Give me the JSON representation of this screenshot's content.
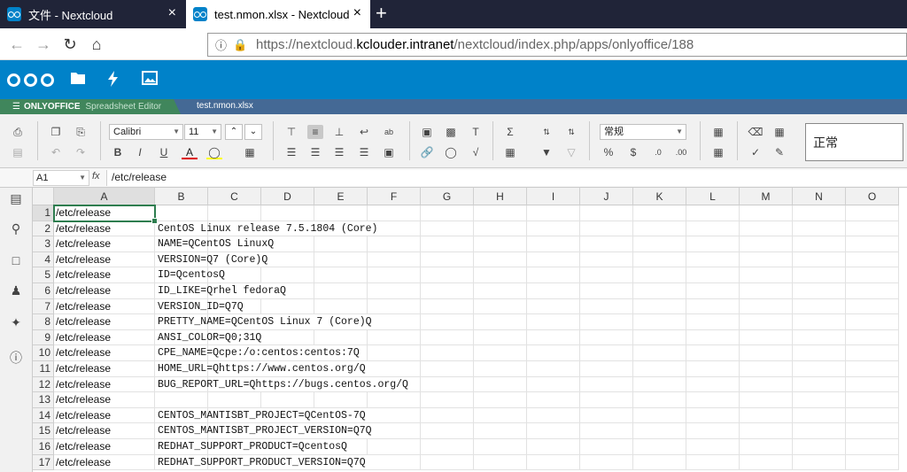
{
  "browser": {
    "tabs": [
      {
        "title": "文件 - Nextcloud",
        "active": false
      },
      {
        "title": "test.nmon.xlsx - Nextcloud",
        "active": true
      }
    ],
    "new_tab_label": "+",
    "close_label": "×",
    "url_scheme": "https://nextcloud.",
    "url_host": "kclouder.intranet",
    "url_path": "/nextcloud/index.php/apps/onlyoffice/188"
  },
  "nextcloud": {
    "apps": [
      "files-icon",
      "activity-icon",
      "gallery-icon"
    ],
    "brand_color": "#0082c9"
  },
  "onlyoffice": {
    "brand": "ONLYOFFICE",
    "editor_label": "Spreadsheet Editor",
    "file_name": "test.nmon.xlsx"
  },
  "toolbar": {
    "font_name": "Calibri",
    "font_size": "11",
    "number_format": "常规",
    "cell_style": "正常"
  },
  "formula_bar": {
    "cell_ref": "A1",
    "fx": "fx",
    "value": "/etc/release"
  },
  "grid": {
    "columns": [
      "A",
      "B",
      "C",
      "D",
      "E",
      "F",
      "G",
      "H",
      "I",
      "J",
      "K",
      "L",
      "M",
      "N",
      "O"
    ],
    "selected_column": "A",
    "selected_row": 1,
    "rows": [
      {
        "n": "1",
        "a": "/etc/release",
        "b": ""
      },
      {
        "n": "2",
        "a": "/etc/release",
        "b": "CentOS Linux release 7.5.1804 (Core)"
      },
      {
        "n": "3",
        "a": "/etc/release",
        "b": "NAME=QCentOS LinuxQ"
      },
      {
        "n": "4",
        "a": "/etc/release",
        "b": "VERSION=Q7 (Core)Q"
      },
      {
        "n": "5",
        "a": "/etc/release",
        "b": "ID=QcentosQ"
      },
      {
        "n": "6",
        "a": "/etc/release",
        "b": "ID_LIKE=Qrhel fedoraQ"
      },
      {
        "n": "7",
        "a": "/etc/release",
        "b": "VERSION_ID=Q7Q"
      },
      {
        "n": "8",
        "a": "/etc/release",
        "b": "PRETTY_NAME=QCentOS Linux 7 (Core)Q"
      },
      {
        "n": "9",
        "a": "/etc/release",
        "b": "ANSI_COLOR=Q0;31Q"
      },
      {
        "n": "10",
        "a": "/etc/release",
        "b": "CPE_NAME=Qcpe:/o:centos:centos:7Q"
      },
      {
        "n": "11",
        "a": "/etc/release",
        "b": "HOME_URL=Qhttps://www.centos.org/Q"
      },
      {
        "n": "12",
        "a": "/etc/release",
        "b": "BUG_REPORT_URL=Qhttps://bugs.centos.org/Q"
      },
      {
        "n": "13",
        "a": "/etc/release",
        "b": ""
      },
      {
        "n": "14",
        "a": "/etc/release",
        "b": "CENTOS_MANTISBT_PROJECT=QCentOS-7Q"
      },
      {
        "n": "15",
        "a": "/etc/release",
        "b": "CENTOS_MANTISBT_PROJECT_VERSION=Q7Q"
      },
      {
        "n": "16",
        "a": "/etc/release",
        "b": "REDHAT_SUPPORT_PRODUCT=QcentosQ"
      },
      {
        "n": "17",
        "a": "/etc/release",
        "b": "REDHAT_SUPPORT_PRODUCT_VERSION=Q7Q"
      }
    ]
  }
}
